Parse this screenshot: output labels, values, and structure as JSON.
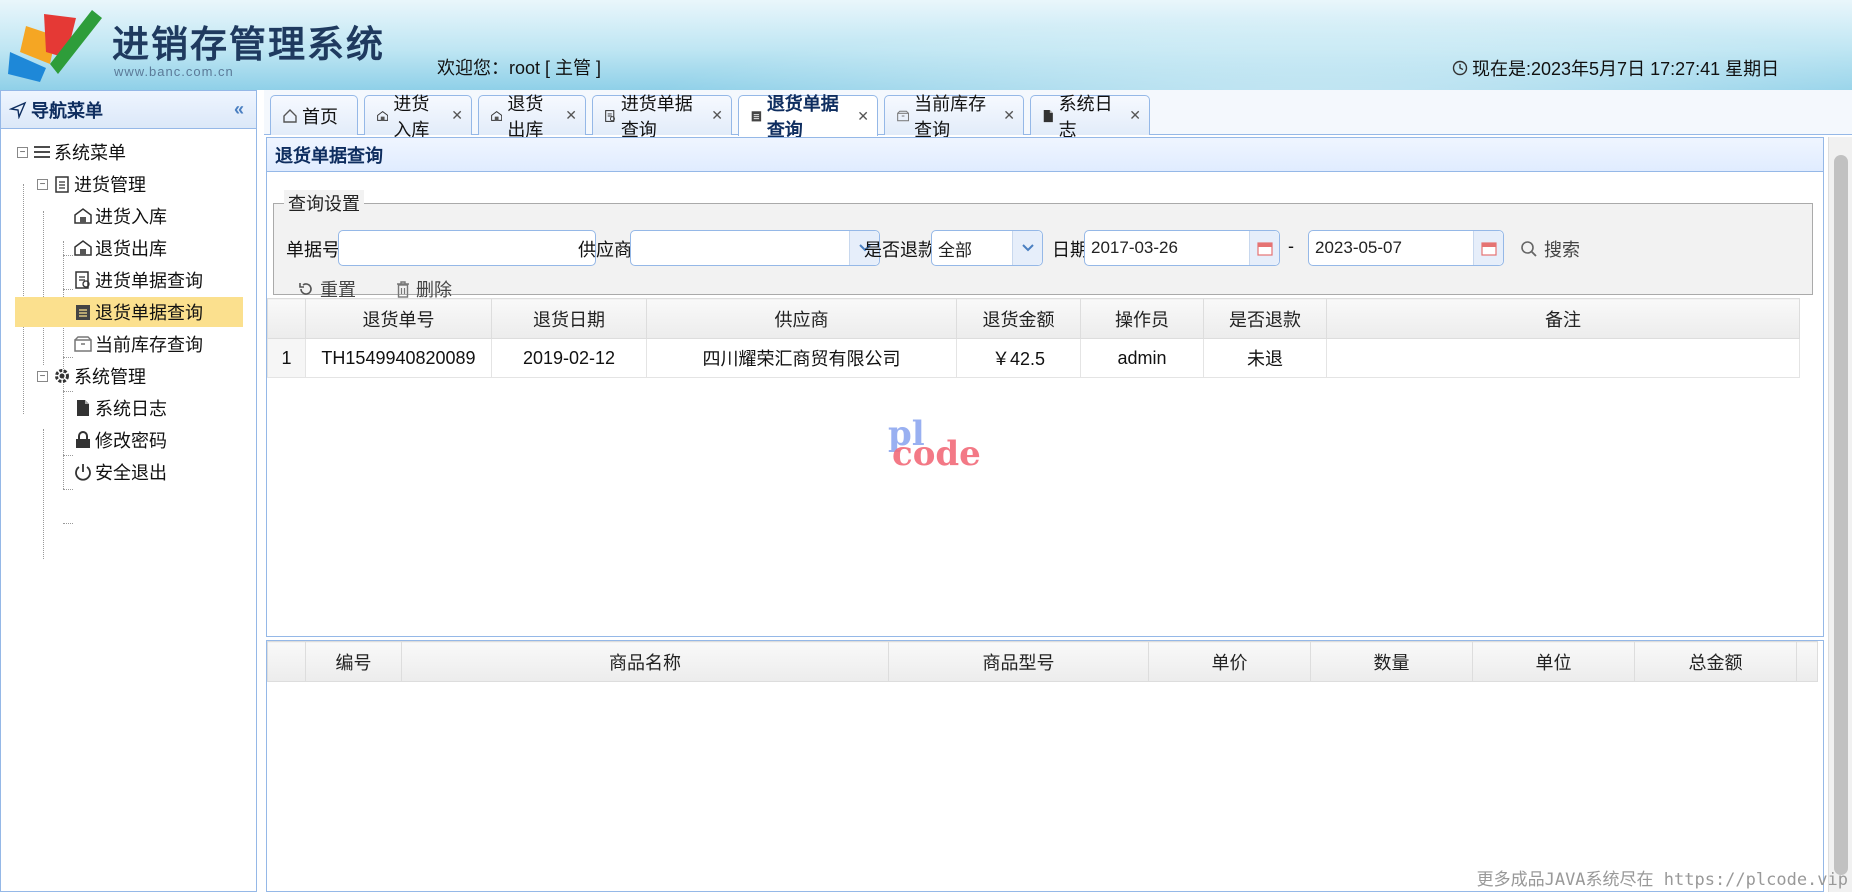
{
  "header": {
    "title": "进销存管理系统",
    "url": "www.banc.com.cn",
    "welcome": "欢迎您：root [ 主管 ]",
    "clock": "现在是:2023年5月7日 17:27:41 星期日"
  },
  "sidebar": {
    "title": "导航菜单",
    "root": "系统菜单",
    "groups": [
      {
        "label": "进货管理",
        "items": [
          {
            "label": "进货入库",
            "icon": "warehouse-in-icon"
          },
          {
            "label": "退货出库",
            "icon": "warehouse-out-icon"
          },
          {
            "label": "进货单据查询",
            "icon": "document-search-icon"
          },
          {
            "label": "退货单据查询",
            "icon": "return-document-icon"
          },
          {
            "label": "当前库存查询",
            "icon": "inventory-box-icon"
          }
        ]
      },
      {
        "label": "系统管理",
        "items": [
          {
            "label": "系统日志",
            "icon": "log-file-icon"
          },
          {
            "label": "修改密码",
            "icon": "lock-icon"
          },
          {
            "label": "安全退出",
            "icon": "power-icon"
          }
        ]
      }
    ]
  },
  "tabs": [
    {
      "label": "首页",
      "icon": "home-icon"
    },
    {
      "label": "进货入库",
      "icon": "warehouse-in-icon"
    },
    {
      "label": "退货出库",
      "icon": "warehouse-out-icon"
    },
    {
      "label": "进货单据查询",
      "icon": "document-search-icon"
    },
    {
      "label": "退货单据查询",
      "icon": "return-document-icon"
    },
    {
      "label": "当前库存查询",
      "icon": "inventory-box-icon"
    },
    {
      "label": "系统日志",
      "icon": "log-file-icon"
    }
  ],
  "panel": {
    "title": "退货单据查询"
  },
  "query": {
    "legend": "查询设置",
    "bill_no_label": "单据号:",
    "bill_no_value": "",
    "supplier_label": "供应商:",
    "supplier_value": "",
    "refund_label": "是否退款:",
    "refund_value": "全部",
    "date_label": "日期:",
    "date_from": "2017-03-26",
    "date_sep": "-",
    "date_to": "2023-05-07",
    "search_label": "搜索",
    "reset_label": "重置",
    "delete_label": "删除"
  },
  "bill_grid": {
    "columns": [
      "退货单号",
      "退货日期",
      "供应商",
      "退货金额",
      "操作员",
      "是否退款",
      "备注"
    ],
    "rows": [
      {
        "num": "1",
        "cells": [
          "TH1549940820089",
          "2019-02-12",
          "四川耀荣汇商贸有限公司",
          "￥42.5",
          "admin",
          "未退",
          ""
        ]
      }
    ]
  },
  "detail_grid": {
    "columns": [
      "编号",
      "商品名称",
      "商品型号",
      "单价",
      "数量",
      "单位",
      "总金额"
    ]
  },
  "watermark": {
    "top": "pl",
    "bottom": "code"
  },
  "footer": "更多成品JAVA系统尽在 https://plcode.vip",
  "colors": {
    "border": "#95b8e7",
    "selected": "#fbe08e",
    "accent": "#0e2d5f"
  }
}
